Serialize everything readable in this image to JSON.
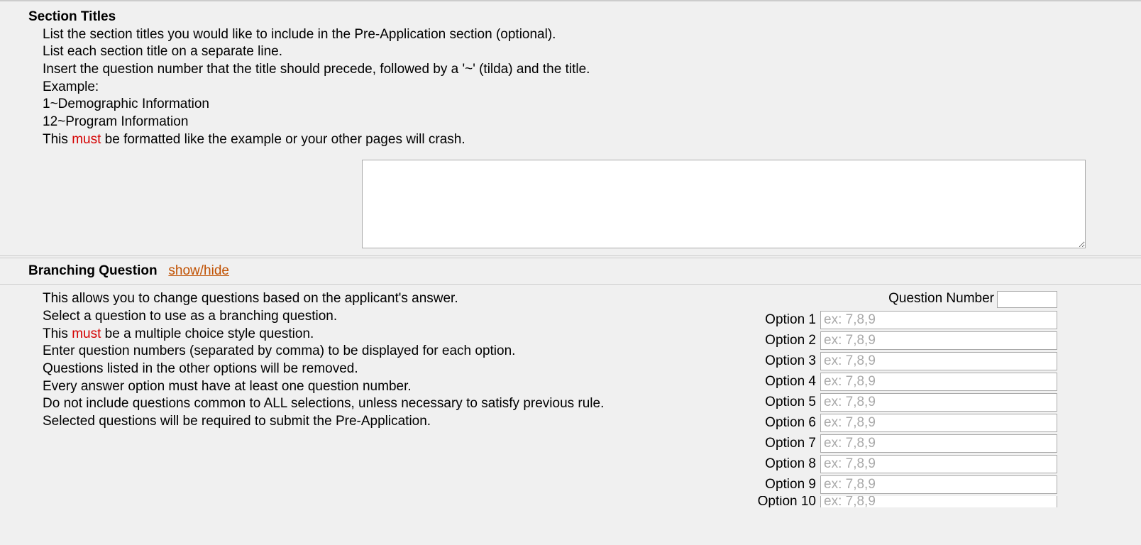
{
  "section_titles": {
    "heading": "Section Titles",
    "lines": [
      "List the section titles you would like to include in the Pre-Application section (optional).",
      "List each section title on a separate line.",
      "Insert the question number that the title should precede, followed by a '~' (tilda) and the title.",
      "Example:",
      "1~Demographic Information",
      "12~Program Information"
    ],
    "must_line_prefix": "This ",
    "must_word": "must",
    "must_line_suffix": " be formatted like the example or your other pages will crash."
  },
  "branching": {
    "heading": "Branching Question",
    "toggle": "show/hide",
    "lines_pre": [
      "This allows you to change questions based on the applicant's answer.",
      "Select a question to use as a branching question."
    ],
    "must_line_prefix": "This ",
    "must_word": "must",
    "must_line_suffix": " be a multiple choice style question.",
    "lines_post": [
      "Enter question numbers (separated by comma) to be displayed for each option.",
      "Questions listed in the other options will be removed.",
      "Every answer option must have at least one question number.",
      "Do not include questions common to ALL selections, unless necessary to satisfy previous rule.",
      "Selected questions will be required to submit the Pre-Application."
    ],
    "question_number_label": "Question Number",
    "option_placeholder": "ex: 7,8,9",
    "options": [
      "Option 1",
      "Option 2",
      "Option 3",
      "Option 4",
      "Option 5",
      "Option 6",
      "Option 7",
      "Option 8",
      "Option 9",
      "Option 10"
    ]
  }
}
